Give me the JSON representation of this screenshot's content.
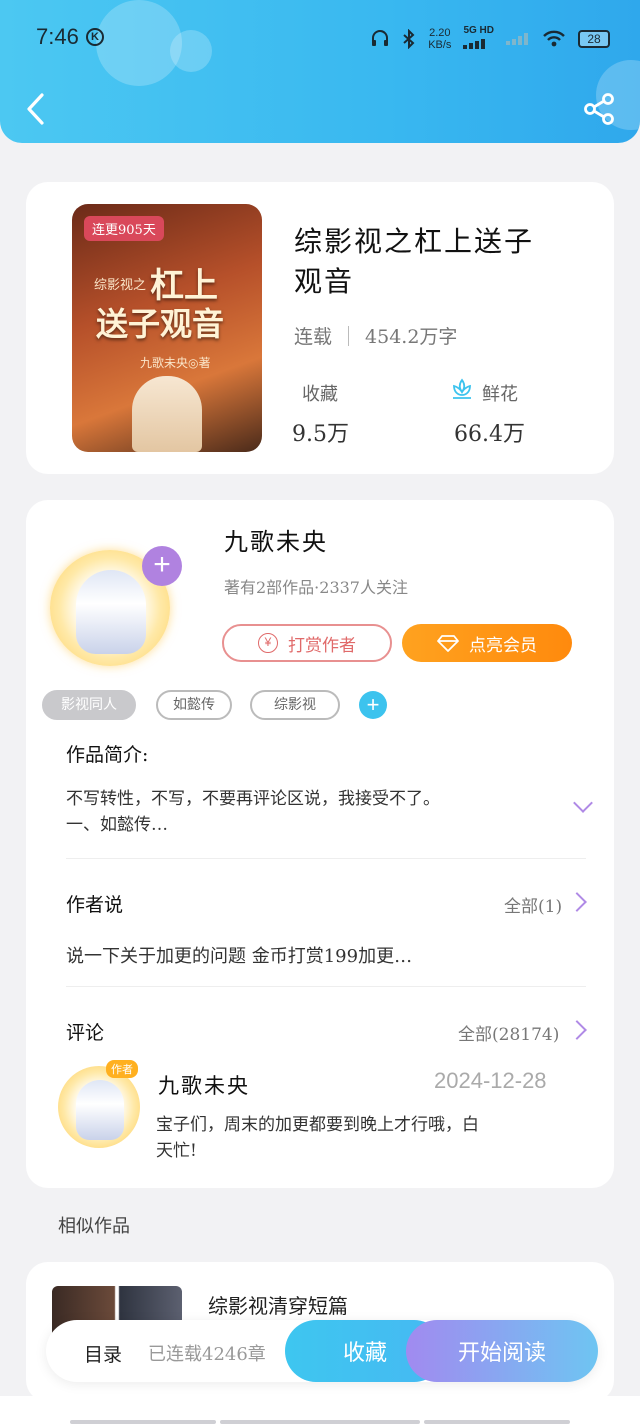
{
  "status_bar": {
    "time": "7:46",
    "k_badge": "K",
    "net_speed_value": "2.20",
    "net_speed_unit": "KB/s",
    "network": "5G HD",
    "battery": "28"
  },
  "book": {
    "cover_badge": "连更905天",
    "cover_title_line1": "杠上",
    "cover_title_line2": "送子观音",
    "cover_subtitle": "综影视之",
    "cover_author": "九歌未央◎著",
    "title_line1": "综影视之杠上送子",
    "title_line2": "观音",
    "status": "连载",
    "word_count": "454.2万字",
    "collect_label": "收藏",
    "collect_value": "9.5万",
    "flower_label": "鲜花",
    "flower_value": "66.4万"
  },
  "author": {
    "name": "九歌未央",
    "summary": "著有2部作品·2337人关注",
    "tip_button": "打赏作者",
    "tip_icon_text": "¥",
    "vip_button": "点亮会员",
    "plus": "+"
  },
  "tags": [
    "影视同人",
    "如懿传",
    "综影视"
  ],
  "tag_add": "+",
  "intro": {
    "title": "作品简介:",
    "line1": "不写转性，不写，不要再评论区说，我接受不了。",
    "line2": "一、如懿传…"
  },
  "author_says": {
    "title": "作者说",
    "link": "全部(1)",
    "text": "说一下关于加更的问题 金币打赏199加更…"
  },
  "comments": {
    "title": "评论",
    "link": "全部(28174)",
    "badge": "作者",
    "author": "九歌未央",
    "date": "2024-12-28",
    "line1": "宝子们，周末的加更都要到晚上才行哦，白",
    "line2": "天忙!"
  },
  "similar": {
    "title": "相似作品",
    "item_name": "综影视清穿短篇"
  },
  "bottom_bar": {
    "toc": "目录",
    "status": "已连载4246章",
    "favorite": "收藏",
    "read": "开始阅读"
  },
  "colors": {
    "header_blue": "#39b8f0",
    "accent_purple": "#b082e0",
    "vip_orange": "#ff9416",
    "tip_red": "#e06a6a"
  }
}
